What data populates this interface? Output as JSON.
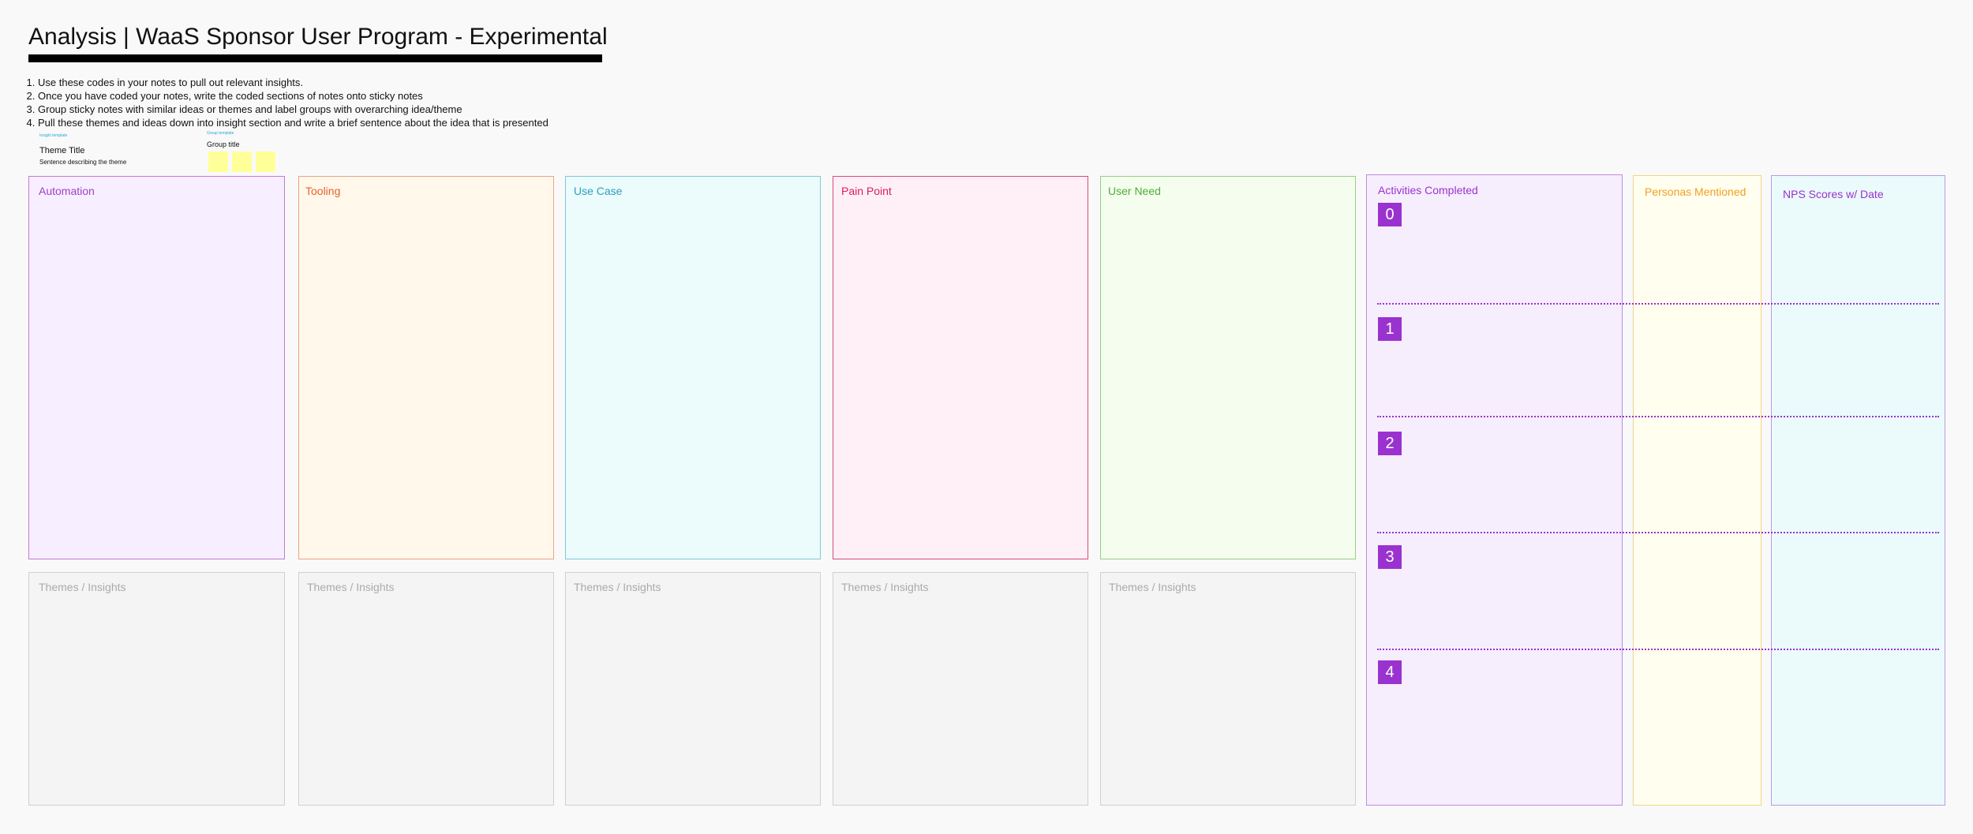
{
  "header": {
    "title": "Analysis | WaaS Sponsor User Program - Experimental"
  },
  "instructions": [
    "Use these codes in your notes to pull out relevant insights.",
    "Once you have coded your notes, write the coded sections of notes onto sticky notes",
    "Group sticky notes with similar ideas or themes and label groups with overarching idea/theme",
    "Pull these themes and ideas down into insight section and write a brief sentence about the idea that is presented"
  ],
  "insight_template": {
    "label": "Insight template",
    "title": "Theme Title",
    "description": "Sentence describing the theme"
  },
  "group_template": {
    "label": "Group template",
    "title": "Group title"
  },
  "code_panels": [
    {
      "label": "Automation",
      "color": "#a040c8",
      "border": "#c47ad6",
      "bg": "#f7efff"
    },
    {
      "label": "Tooling",
      "color": "#e8612c",
      "border": "#eea385",
      "bg": "#fff8eb"
    },
    {
      "label": "Use Case",
      "color": "#2aa0c0",
      "border": "#80c8dc",
      "bg": "#ecfbfb"
    },
    {
      "label": "Pain Point",
      "color": "#d81b60",
      "border": "#d84a78",
      "bg": "#fff0f8"
    },
    {
      "label": "User Need",
      "color": "#4caf35",
      "border": "#95cf85",
      "bg": "#f5fdee"
    }
  ],
  "insight_panels": [
    {
      "label": "Themes / Insights"
    },
    {
      "label": "Themes / Insights"
    },
    {
      "label": "Themes / Insights"
    },
    {
      "label": "Themes / Insights"
    },
    {
      "label": "Themes / Insights"
    }
  ],
  "activities": {
    "label": "Activities Completed",
    "color": "#9a32cf",
    "levels": [
      "0",
      "1",
      "2",
      "3",
      "4"
    ]
  },
  "personas": {
    "label": "Personas Mentioned",
    "color": "#f0a020"
  },
  "nps": {
    "label": "NPS Scores w/ Date",
    "color": "#9a32cf"
  }
}
